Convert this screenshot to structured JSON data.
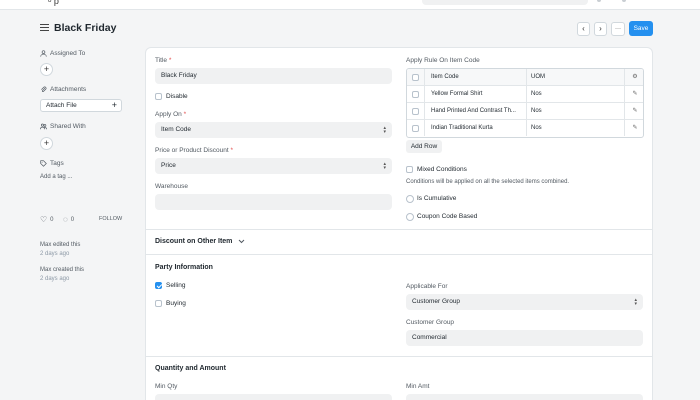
{
  "header": {
    "title": "Black Friday",
    "more_label": "···",
    "save_label": "Save"
  },
  "sidebar": {
    "assigned_to_label": "Assigned To",
    "attachments_label": "Attachments",
    "attach_file_label": "Attach File",
    "shared_with_label": "Shared With",
    "tags_label": "Tags",
    "add_tag_label": "Add a tag ...",
    "likes_count": "0",
    "comments_count": "0",
    "follow_label": "FOLLOW",
    "activity": [
      {
        "text": "Max edited this",
        "time": "2 days ago"
      },
      {
        "text": "Max created this",
        "time": "2 days ago"
      }
    ]
  },
  "form": {
    "title_label": "Title",
    "title_value": "Black Friday",
    "disable_label": "Disable",
    "apply_on_label": "Apply On",
    "apply_on_value": "Item Code",
    "price_discount_label": "Price or Product Discount",
    "price_discount_value": "Price",
    "warehouse_label": "Warehouse",
    "warehouse_value": "",
    "apply_rule_label": "Apply Rule On Item Code",
    "grid": {
      "headers": [
        "Item Code",
        "UOM"
      ],
      "rows": [
        {
          "item": "Yellow Formal Shirt",
          "uom": "Nos"
        },
        {
          "item": "Hand Printed And Contrast Th...",
          "uom": "Nos"
        },
        {
          "item": "Indian Traditional Kurta",
          "uom": "Nos"
        }
      ]
    },
    "add_row_label": "Add Row",
    "mixed_conditions_label": "Mixed Conditions",
    "mixed_conditions_desc": "Conditions will be applied on all the selected items combined.",
    "is_cumulative_label": "Is Cumulative",
    "coupon_code_label": "Coupon Code Based",
    "discount_other_item_label": "Discount on Other Item",
    "party_info_label": "Party Information",
    "selling_label": "Selling",
    "buying_label": "Buying",
    "applicable_for_label": "Applicable For",
    "applicable_for_value": "Customer Group",
    "customer_group_label": "Customer Group",
    "customer_group_value": "Commercial",
    "qty_amount_label": "Quantity and Amount",
    "min_qty_label": "Min Qty",
    "min_amt_label": "Min Amt"
  },
  "colors": {
    "primary": "#2490ef",
    "required": "#e24c4c"
  }
}
